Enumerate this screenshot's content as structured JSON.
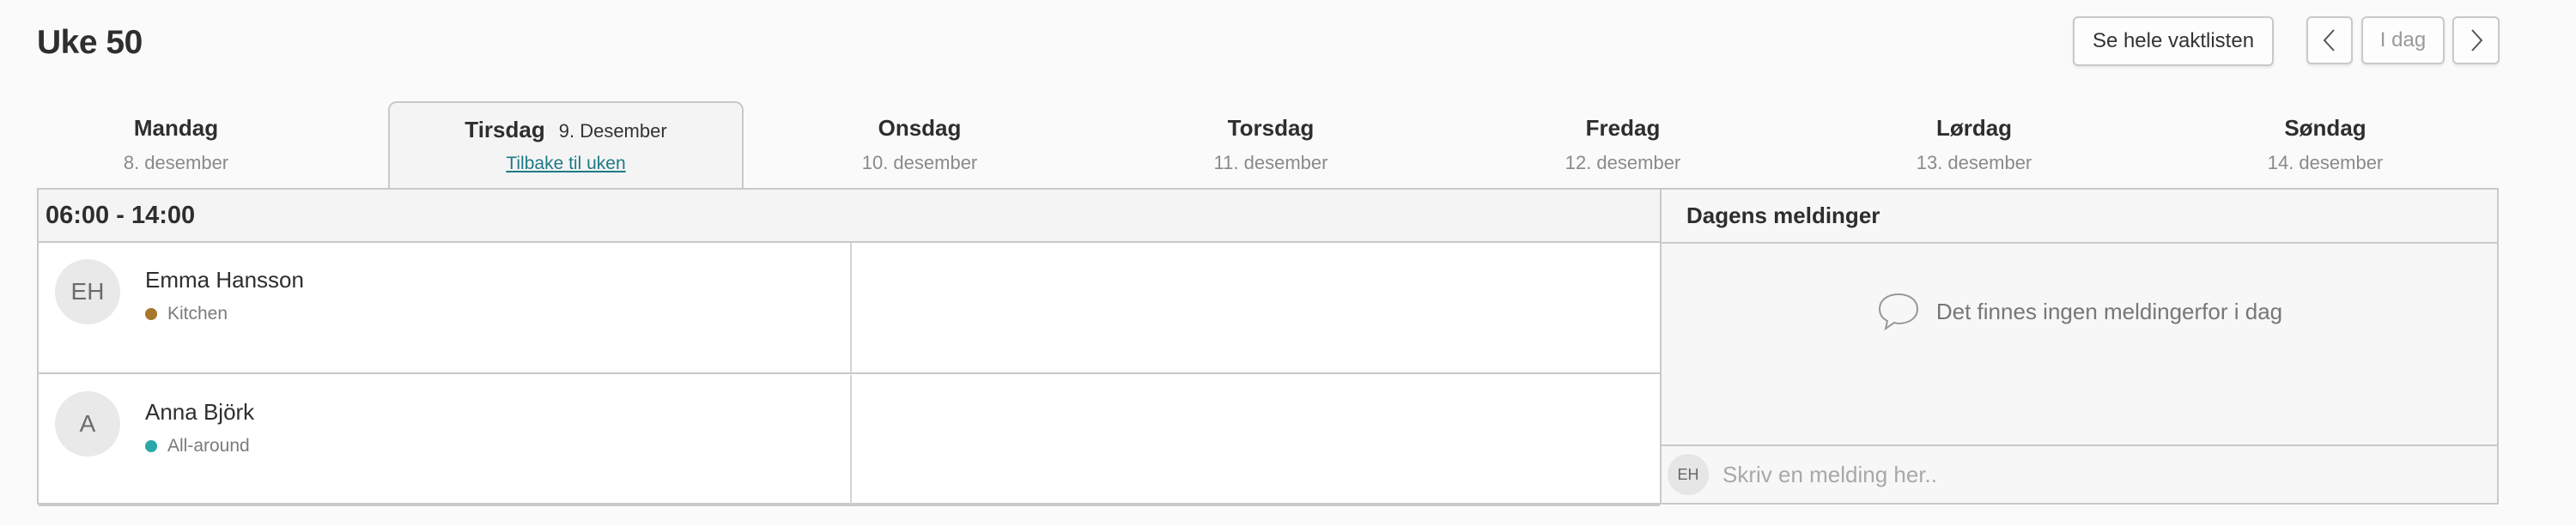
{
  "header": {
    "week_title": "Uke 50",
    "see_all_label": "Se hele vaktlisten",
    "today_label": "I dag"
  },
  "days": [
    {
      "name": "Mandag",
      "date": "8. desember"
    },
    {
      "name": "Tirsdag",
      "date": "9. Desember",
      "back_label": "Tilbake til uken"
    },
    {
      "name": "Onsdag",
      "date": "10. desember"
    },
    {
      "name": "Torsdag",
      "date": "11. desember"
    },
    {
      "name": "Fredag",
      "date": "12. desember"
    },
    {
      "name": "Lørdag",
      "date": "13. desember"
    },
    {
      "name": "Søndag",
      "date": "14. desember"
    }
  ],
  "shift": {
    "time": "06:00 - 14:00",
    "employees": [
      {
        "initials": "EH",
        "name": "Emma Hansson",
        "role": "Kitchen",
        "role_color": "#a7772a"
      },
      {
        "initials": "A",
        "name": "Anna Björk",
        "role": "All-around",
        "role_color": "#2aa8a8"
      }
    ]
  },
  "messages": {
    "title": "Dagens meldinger",
    "empty_text": "Det finnes ingen meldingerfor i dag",
    "user_initials": "EH",
    "input_placeholder": "Skriv en melding her.."
  }
}
